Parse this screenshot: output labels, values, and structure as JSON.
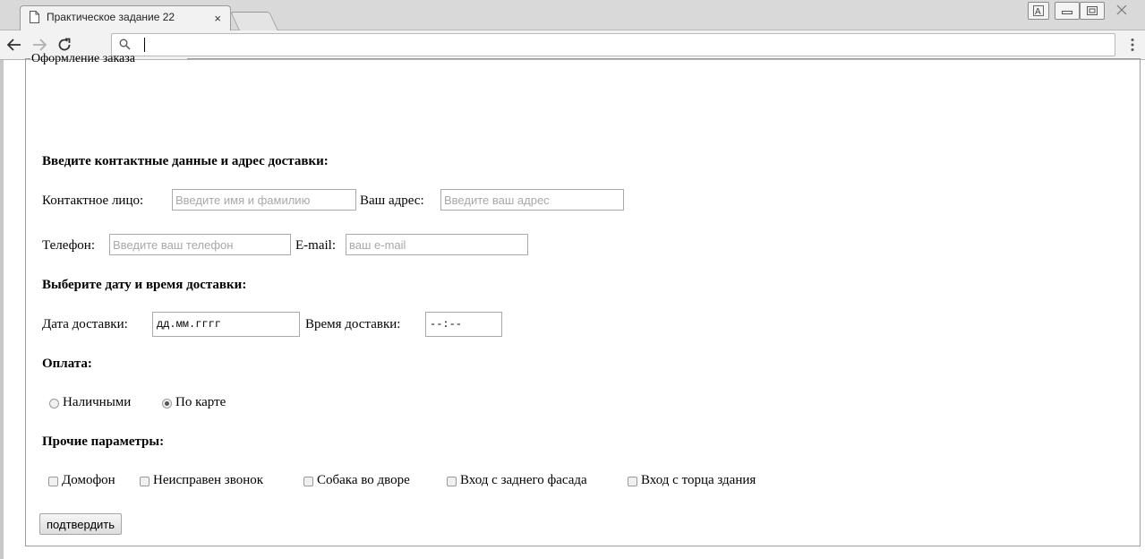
{
  "browser": {
    "tab_title": "Практическое задание 22",
    "tab_close": "×",
    "address_value": ""
  },
  "form": {
    "legend": "Оформление заказа",
    "section_contact": "Введите контактные данные и адрес доставки:",
    "contact_person_label": "Контактное лицо:",
    "contact_person_placeholder": "Введите имя и фамилию",
    "address_label": "Ваш адрес:",
    "address_placeholder": "Введите ваш адрес",
    "phone_label": "Телефон:",
    "phone_placeholder": "Введите ваш телефон",
    "email_label": "E-mail:",
    "email_placeholder": "ваш e-mail",
    "section_datetime": "Выберите дату и время доставки:",
    "date_label": "Дата доставки:",
    "date_value": "дд.мм.гггг",
    "time_label": "Время доставки:",
    "time_value": "--:--",
    "section_payment": "Оплата:",
    "payment_cash": "Наличными",
    "payment_card": "По карте",
    "payment_selected": "По карте",
    "section_other": "Прочие параметры:",
    "options": [
      "Домофон",
      "Неисправен звонок",
      "Собака во дворе",
      "Вход с заднего фасада",
      "Вход с торца здания"
    ],
    "submit": "подтвердить"
  }
}
